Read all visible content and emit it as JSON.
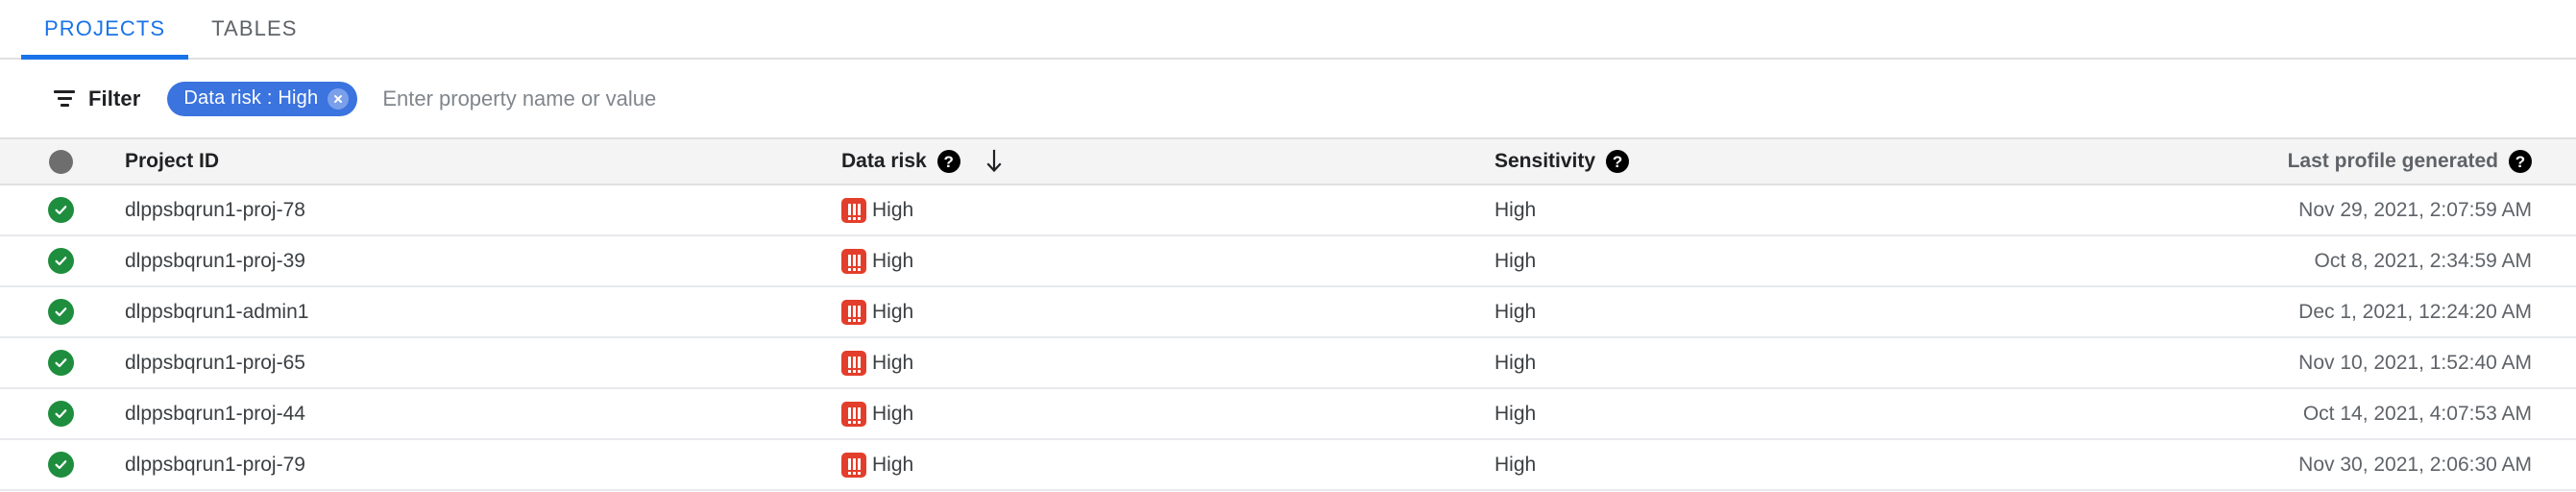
{
  "tabs": [
    {
      "label": "PROJECTS",
      "active": true
    },
    {
      "label": "TABLES",
      "active": false
    }
  ],
  "filter_bar": {
    "icon": "filter-icon",
    "label": "Filter",
    "chip": {
      "text": "Data risk : High",
      "close_icon": "close-circle-icon"
    },
    "input_placeholder": "Enter property name or value",
    "input_value": ""
  },
  "table": {
    "columns": [
      {
        "key": "select",
        "label": "",
        "icon": "selection-circle-icon",
        "help": false
      },
      {
        "key": "project_id",
        "label": "Project ID",
        "help": false
      },
      {
        "key": "data_risk",
        "label": "Data risk",
        "help": true,
        "help_icon": "help-icon",
        "sorted": true,
        "sort_direction": "descending",
        "sort_icon": "arrow-down-icon"
      },
      {
        "key": "sensitivity",
        "label": "Sensitivity",
        "help": true,
        "help_icon": "help-icon"
      },
      {
        "key": "last_profile_generated",
        "label": "Last profile generated",
        "help": true,
        "help_icon": "help-icon"
      }
    ],
    "rows": [
      {
        "status_icon": "check-circle-icon",
        "project_id": "dlppsbqrun1-proj-78",
        "data_risk": "High",
        "risk_icon": "high-risk-icon",
        "sensitivity": "High",
        "last_profile_generated": "Nov 29, 2021, 2:07:59 AM"
      },
      {
        "status_icon": "check-circle-icon",
        "project_id": "dlppsbqrun1-proj-39",
        "data_risk": "High",
        "risk_icon": "high-risk-icon",
        "sensitivity": "High",
        "last_profile_generated": "Oct 8, 2021, 2:34:59 AM"
      },
      {
        "status_icon": "check-circle-icon",
        "project_id": "dlppsbqrun1-admin1",
        "data_risk": "High",
        "risk_icon": "high-risk-icon",
        "sensitivity": "High",
        "last_profile_generated": "Dec 1, 2021, 12:24:20 AM"
      },
      {
        "status_icon": "check-circle-icon",
        "project_id": "dlppsbqrun1-proj-65",
        "data_risk": "High",
        "risk_icon": "high-risk-icon",
        "sensitivity": "High",
        "last_profile_generated": "Nov 10, 2021, 1:52:40 AM"
      },
      {
        "status_icon": "check-circle-icon",
        "project_id": "dlppsbqrun1-proj-44",
        "data_risk": "High",
        "risk_icon": "high-risk-icon",
        "sensitivity": "High",
        "last_profile_generated": "Oct 14, 2021, 4:07:53 AM"
      },
      {
        "status_icon": "check-circle-icon",
        "project_id": "dlppsbqrun1-proj-79",
        "data_risk": "High",
        "risk_icon": "high-risk-icon",
        "sensitivity": "High",
        "last_profile_generated": "Nov 30, 2021, 2:06:30 AM"
      }
    ]
  },
  "colors": {
    "accent_blue": "#1a73e8",
    "chip_blue": "#3b73df",
    "risk_red": "#e33e2b",
    "status_green": "#1e8e3e",
    "header_bg": "#f4f4f4"
  }
}
